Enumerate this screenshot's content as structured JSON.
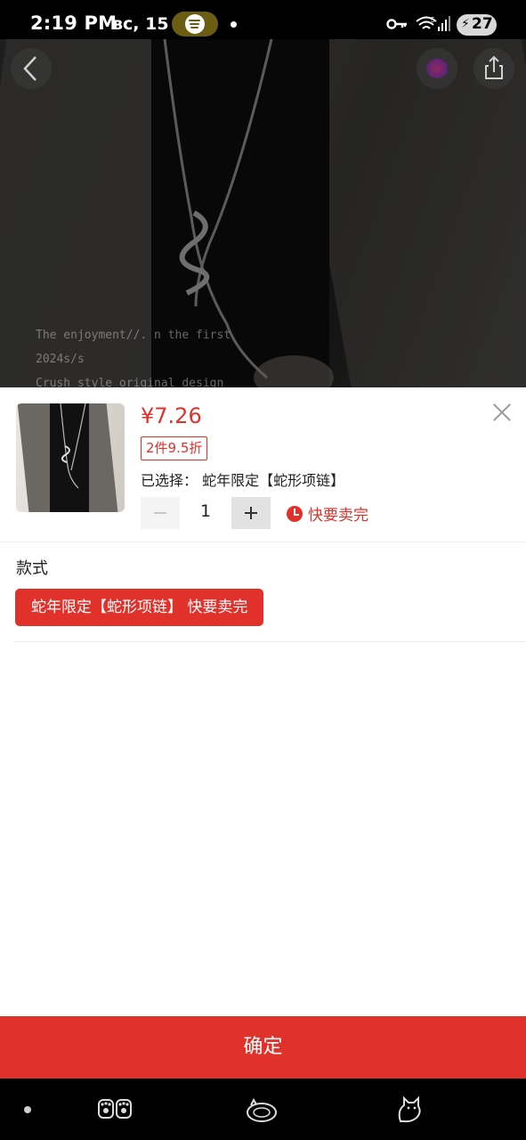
{
  "status_bar": {
    "time": "2:19 PM",
    "date": "вс, 15",
    "battery": "27",
    "icons": [
      "spotify-icon",
      "key-icon",
      "wifi-icon",
      "signal-icon",
      "battery-icon"
    ]
  },
  "hero": {
    "watermark_lines": [
      "The enjoyment//.        n the first",
      "2024s/s",
      "Crush style original design"
    ],
    "buttons": [
      "back-arrow-icon",
      "favorite-icon",
      "share-icon"
    ]
  },
  "sheet": {
    "price": "¥7.26",
    "discount_tag": "2件9.5折",
    "selected_label": "已选择：",
    "selected_value": "蛇年限定【蛇形项链】",
    "quantity": "1",
    "stock_warning": "快要卖完",
    "spec_title": "款式",
    "options": [
      {
        "label": "蛇年限定【蛇形项链】  快要卖完",
        "selected": true
      }
    ]
  },
  "confirm_button": "确定",
  "colors": {
    "accent": "#e0312b",
    "background": "#ffffff",
    "status_bar": "#000000"
  }
}
